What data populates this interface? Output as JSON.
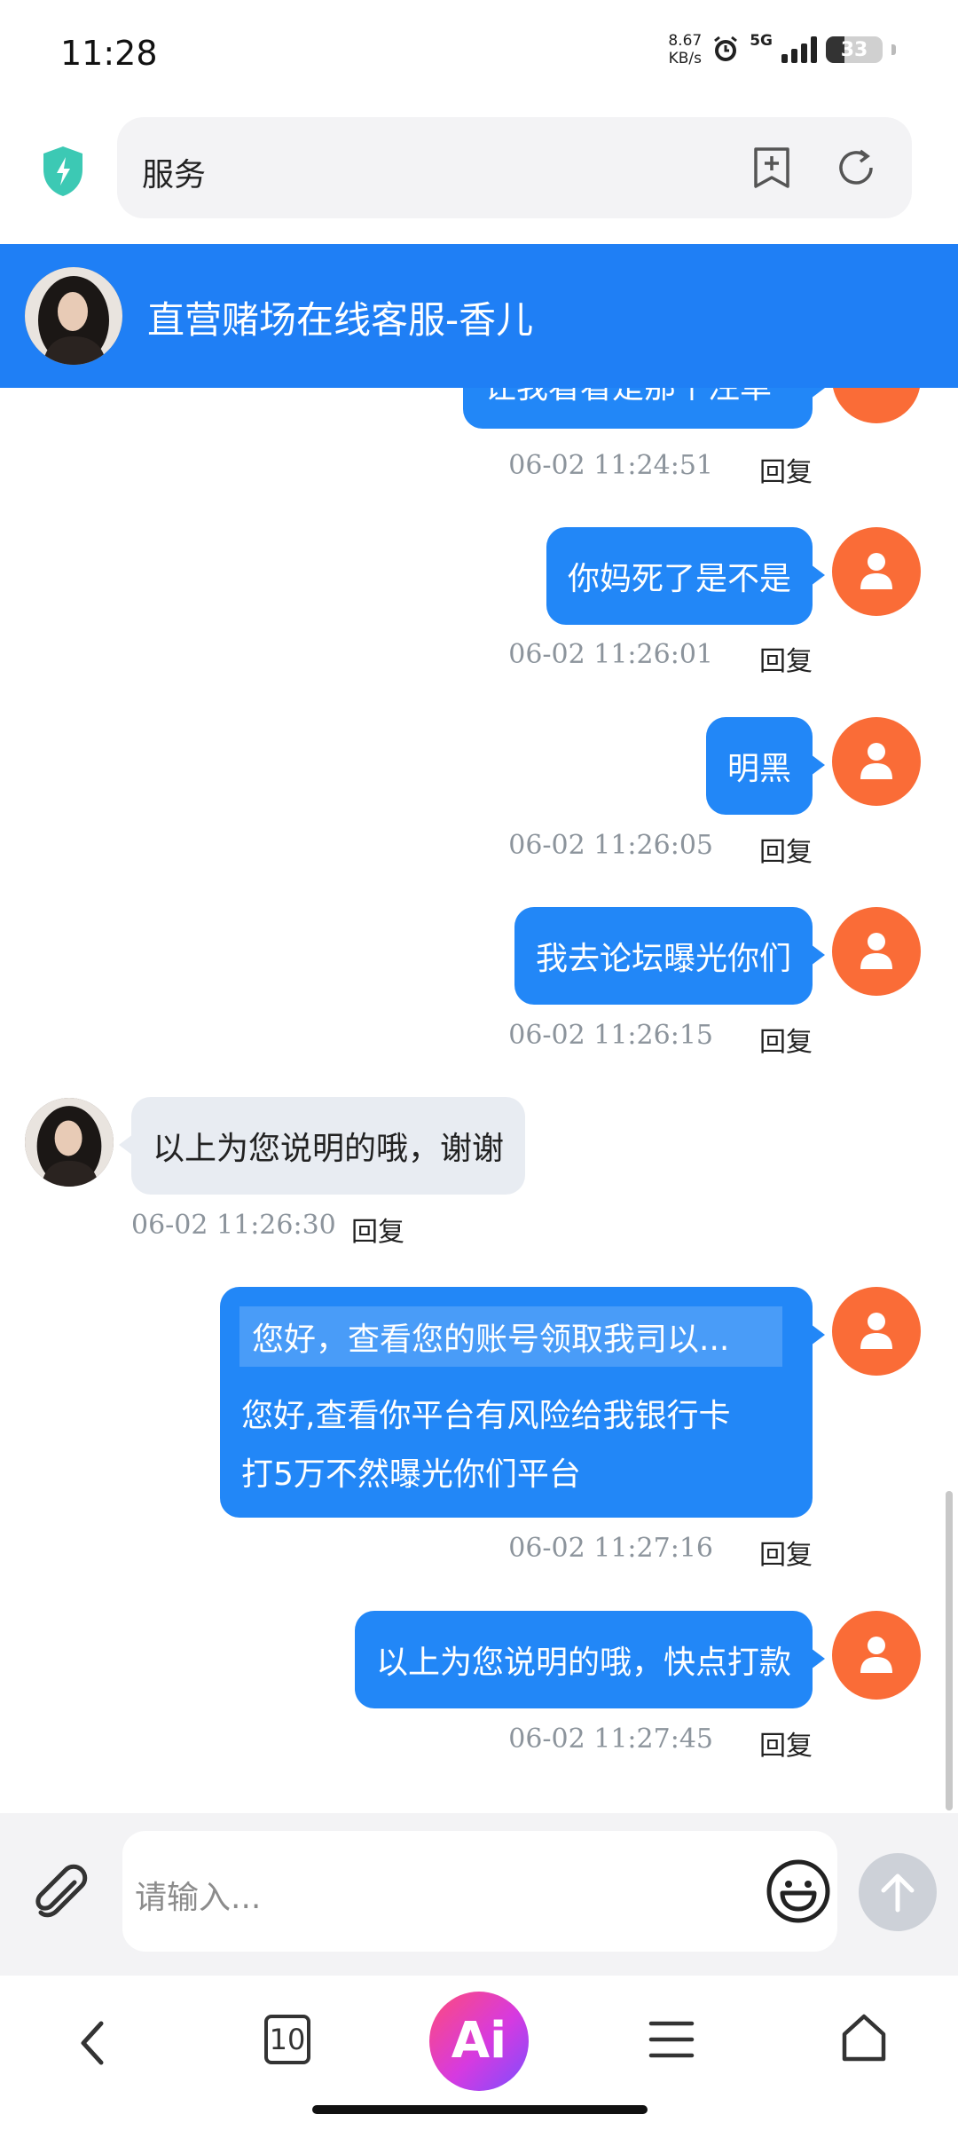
{
  "status_bar": {
    "time": "11:28",
    "net_speed_value": "8.67",
    "net_speed_unit": "KB/s",
    "network": "5G",
    "battery": "33",
    "battery_fraction": 0.33
  },
  "address_bar": {
    "url_text": "服务",
    "icons": [
      "shield-icon",
      "bookmark-add-icon",
      "refresh-icon"
    ]
  },
  "chat": {
    "title": "直营赌场在线客服-香儿",
    "reply_label": "回复",
    "messages": [
      {
        "side": "out",
        "text": "让我看看是那个注单",
        "time": "06-02 11:24:51"
      },
      {
        "side": "out",
        "text": "你妈死了是不是",
        "time": "06-02 11:26:01"
      },
      {
        "side": "out",
        "text": "明黑",
        "time": "06-02 11:26:05"
      },
      {
        "side": "out",
        "text": "我去论坛曝光你们",
        "time": "06-02 11:26:15"
      },
      {
        "side": "in",
        "text": "以上为您说明的哦，谢谢",
        "time": "06-02 11:26:30"
      },
      {
        "side": "out",
        "quote": "您好，查看您的账号领取我司以...",
        "line1": "您好,查看你平台有风险给我银行卡",
        "line2": "打5万不然曝光你们平台",
        "time": "06-02 11:27:16"
      },
      {
        "side": "out",
        "text": "以上为您说明的哦，快点打款",
        "time": "06-02 11:27:45"
      }
    ]
  },
  "input": {
    "placeholder": "请输入..."
  },
  "bottom_nav": {
    "tab_count": "10",
    "ai_label": "Ai"
  },
  "colors": {
    "header_blue": "#1f7ff5",
    "bubble_blue": "#2287f7",
    "user_avatar_orange": "#fa6c37",
    "incoming_bubble": "#e8ecf2"
  }
}
